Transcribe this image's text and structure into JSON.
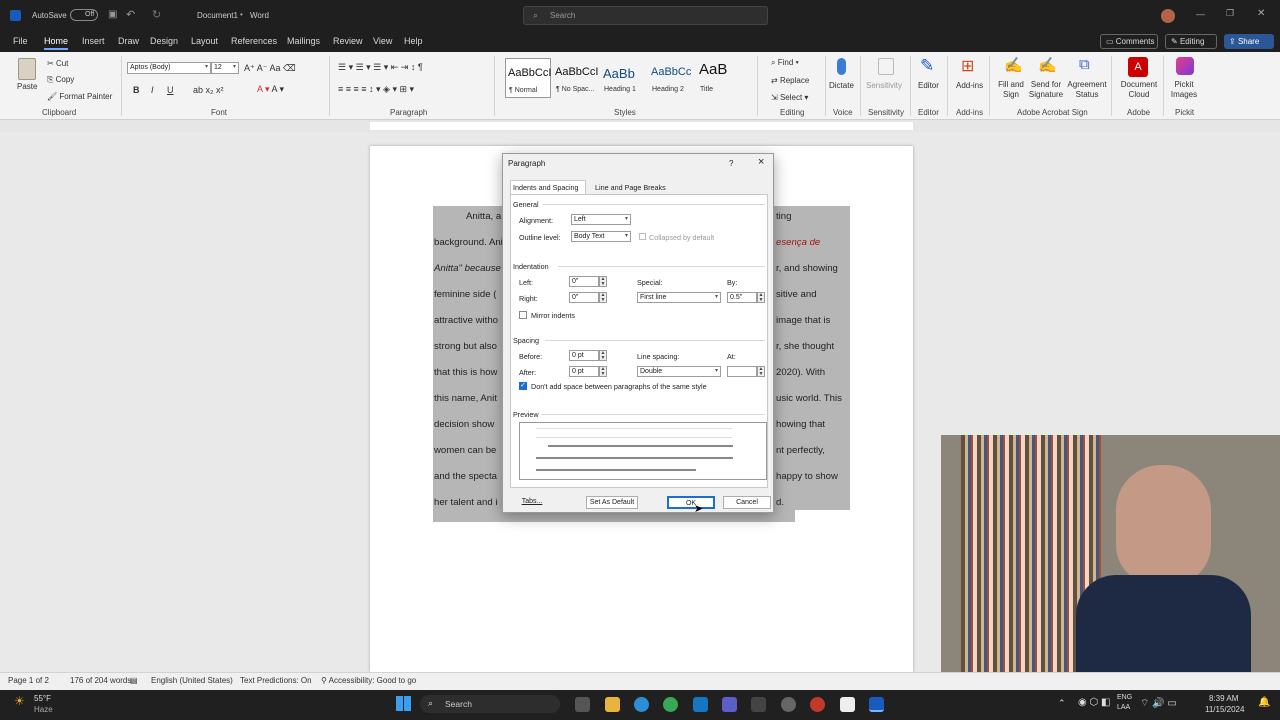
{
  "titlebar": {
    "autosave": "AutoSave",
    "autosave_state": "Off",
    "document": "Document1",
    "app": "Word",
    "search_placeholder": "Search"
  },
  "menu": {
    "file": "File",
    "home": "Home",
    "insert": "Insert",
    "draw": "Draw",
    "design": "Design",
    "layout": "Layout",
    "references": "References",
    "mailings": "Mailings",
    "review": "Review",
    "view": "View",
    "help": "Help",
    "comments": "Comments",
    "editing": "Editing",
    "share": "Share"
  },
  "ribbon": {
    "paste": "Paste",
    "cut": "Cut",
    "copy": "Copy",
    "format_painter": "Format Painter",
    "clipboard": "Clipboard",
    "font_name": "Aptos (Body)",
    "font_size": "12",
    "font": "Font",
    "paragraph": "Paragraph",
    "styles": [
      {
        "sample": "AaBbCcI",
        "label": "¶ Normal"
      },
      {
        "sample": "AaBbCcI",
        "label": "¶ No Spac..."
      },
      {
        "sample": "AaBb",
        "label": "Heading 1"
      },
      {
        "sample": "AaBbCc",
        "label": "Heading 2"
      },
      {
        "sample": "AaB",
        "label": "Title"
      }
    ],
    "styles_label": "Styles",
    "find": "Find",
    "replace": "Replace",
    "select": "Select",
    "editing_label": "Editing",
    "dictate": "Dictate",
    "voice": "Voice",
    "sensitivity": "Sensitivity",
    "sensitivity_group": "Sensitivity",
    "editor": "Editor",
    "editor_group": "Editor",
    "addins": "Add-ins",
    "addins_group": "Add-ins",
    "fill_sign": "Fill and Sign",
    "send_sig": "Send for Signature",
    "agreement": "Agreement Status",
    "adobe_sign": "Adobe Acrobat Sign",
    "doc_cloud": "Document Cloud",
    "adobe": "Adobe",
    "pickit": "Pickit Images",
    "pickit_group": "Pickit"
  },
  "doc_lines": [
    {
      "left": "Anitta, a",
      "right": "ting"
    },
    {
      "left": "background. Ani",
      "right": "esença de"
    },
    {
      "left": "Anitta\" because",
      "right": "r, and showing"
    },
    {
      "left": "feminine side (",
      "right": "sitive and"
    },
    {
      "left": "attractive witho",
      "right": "image that is"
    },
    {
      "left": "strong but also",
      "right": "r, she thought"
    },
    {
      "left": "that this is how",
      "right": "2020). With"
    },
    {
      "left": "this name, Anit",
      "right": "usic world. This"
    },
    {
      "left": "decision show",
      "right": "howing that"
    },
    {
      "left": "women can be",
      "right": "nt perfectly,"
    },
    {
      "left": "and the specta",
      "right": "happy to show"
    },
    {
      "left": "her talent and i",
      "right": "d."
    }
  ],
  "dialog": {
    "title": "Paragraph",
    "help": "?",
    "close": "×",
    "tab1": "Indents and Spacing",
    "tab2": "Line and Page Breaks",
    "general": "General",
    "alignment_label": "Alignment:",
    "alignment": "Left",
    "outline_label": "Outline level:",
    "outline": "Body Text",
    "collapsed": "Collapsed by default",
    "indentation": "Indentation",
    "left_label": "Left:",
    "left": "0\"",
    "right_label": "Right:",
    "right": "0\"",
    "special_label": "Special:",
    "special": "First line",
    "by_label": "By:",
    "by": "0.5\"",
    "mirror": "Mirror indents",
    "spacing": "Spacing",
    "before_label": "Before:",
    "before": "0 pt",
    "after_label": "After:",
    "after": "0 pt",
    "line_spacing_label": "Line spacing:",
    "line_spacing": "Double",
    "at_label": "At:",
    "at": "",
    "dont_add": "Don't add space between paragraphs of the same style",
    "preview": "Preview",
    "tabs_btn": "Tabs...",
    "default_btn": "Set As Default",
    "ok_btn": "OK",
    "cancel_btn": "Cancel"
  },
  "status": {
    "page": "Page 1 of 2",
    "words": "176 of 204 words",
    "language": "English (United States)",
    "predictions": "Text Predictions: On",
    "accessibility": "Accessibility: Good to go"
  },
  "taskbar": {
    "temp": "55°F",
    "weather": "Haze",
    "search": "Search",
    "lang1": "ENG",
    "lang2": "LAA",
    "time": "8:39 AM",
    "date": "11/15/2024"
  },
  "colors": {
    "accent": "#185abd",
    "ribbon": "#f3f3f3",
    "dark": "#1f1f1f",
    "selection": "#b6b6b6"
  }
}
